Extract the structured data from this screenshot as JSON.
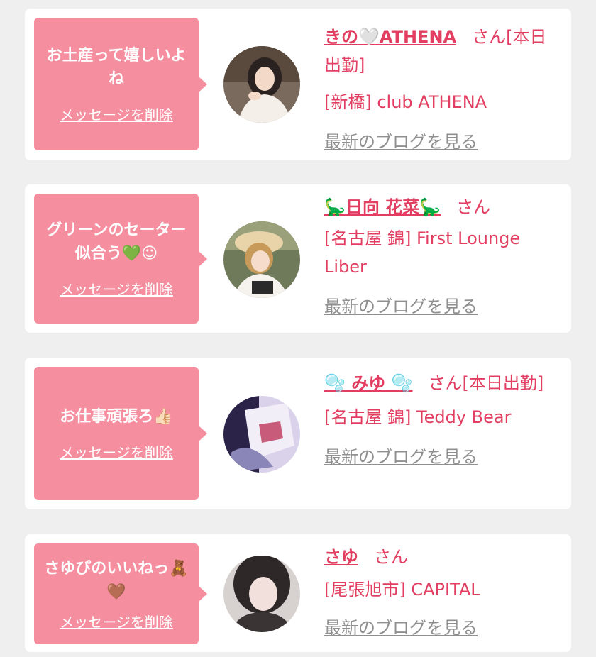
{
  "cards": [
    {
      "message": "お土産って嬉しいよね",
      "delete_label": "メッセージを削除",
      "name": "きの🤍ATHENA",
      "honorific": "さん",
      "status": "[本日出勤]",
      "shop": "[新橋] club ATHENA",
      "blog_label": "最新のブログを見る"
    },
    {
      "message": "グリーンのセーター似合う💚☺",
      "delete_label": "メッセージを削除",
      "name": "🦕日向 花菜🦕",
      "honorific": "さん",
      "shop": "[名古屋 錦] First Lounge Liber",
      "blog_label": "最新のブログを見る"
    },
    {
      "message": "お仕事頑張ろ👍🏻",
      "delete_label": "メッセージを削除",
      "name": "🫧 みゆ 🫧",
      "honorific": "さん",
      "status": "[本日出勤]",
      "shop": "[名古屋 錦] Teddy Bear",
      "blog_label": "最新のブログを見る"
    },
    {
      "message": "さゆぴのいいねっ🧸🤎",
      "delete_label": "メッセージを削除",
      "name": "さゆ",
      "honorific": "さん",
      "shop": "[尾張旭市] CAPITAL",
      "blog_label": "最新のブログを見る"
    }
  ]
}
